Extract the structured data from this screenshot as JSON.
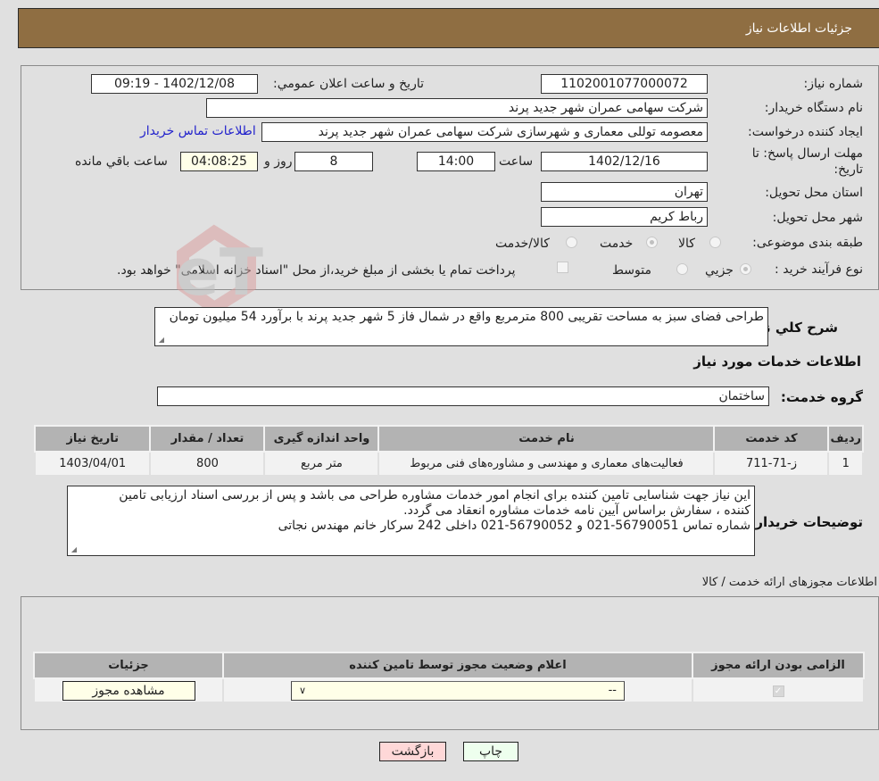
{
  "header": {
    "title": "جزئیات اطلاعات نیاز"
  },
  "form": {
    "need_number": {
      "label": "شماره نیاز:",
      "value": "1102001077000072"
    },
    "announce_datetime": {
      "label": "تاریخ و ساعت اعلان عمومي:",
      "value": "1402/12/08 - 09:19"
    },
    "buyer_org": {
      "label": "نام دستگاه خریدار:",
      "value": "شرکت سهامی عمران شهر جدید پرند"
    },
    "requester": {
      "label": "ایجاد کننده درخواست:",
      "value": "معصومه توللی معماری و شهرسازی شرکت سهامی عمران شهر جدید پرند"
    },
    "buyer_contact_link": "اطلاعات تماس خریدار",
    "deadline": {
      "label_line1": "مهلت ارسال پاسخ: تا",
      "label_line2": "تاریخ:",
      "date": "1402/12/16",
      "time_label": "ساعت",
      "time": "14:00",
      "days": "8",
      "days_label": "روز و",
      "remaining": "04:08:25",
      "remaining_label": "ساعت باقي مانده"
    },
    "province": {
      "label": "استان محل تحویل:",
      "value": "تهران"
    },
    "city": {
      "label": "شهر محل تحویل:",
      "value": "رباط کریم"
    },
    "category": {
      "label": "طبقه بندی موضوعی:",
      "options": [
        "کالا",
        "خدمت",
        "کالا/خدمت"
      ],
      "selected": "خدمت"
    },
    "process_type": {
      "label": "نوع فرآیند خرید :",
      "options": [
        "جزيي",
        "متوسط"
      ],
      "selected": "جزيي",
      "treasury_note": "پرداخت تمام یا بخشی از مبلغ خرید،از محل \"اسناد خزانه اسلامی\" خواهد بود."
    }
  },
  "summary": {
    "label": "شرح كلي نياز:",
    "text": "طراحی فضای سبز به مساحت تقریبی 800 مترمربع واقع در شمال فاز 5 شهر جدید پرند با برآورد 54 میلیون تومان"
  },
  "services": {
    "section_title": "اطلاعات خدمات مورد نیاز",
    "group_label": "گروه خدمت:",
    "group_value": "ساختمان",
    "columns": [
      "ردیف",
      "کد خدمت",
      "نام خدمت",
      "واحد اندازه گیری",
      "تعداد / مقدار",
      "تاریخ نیاز"
    ],
    "rows": [
      [
        "1",
        "ز-71-711",
        "فعالیت‌های معماری و مهندسی و مشاوره‌های فنی مربوط",
        "متر مربع",
        "800",
        "1403/04/01"
      ]
    ]
  },
  "buyer_notes": {
    "label": "توضیحات خریدار:",
    "lines": [
      " این نیاز جهت شناسایی تامین کننده برای انجام امور خدمات مشاوره طراحی می باشد و پس از بررسی اسناد ارزیابی تامین",
      "کننده ، سفارش براساس آیین نامه خدمات مشاوره انعقاد می گردد.",
      "شماره تماس 56790051-021 و 56790052-021 داخلی 242 سرکار خانم مهندس نجاتی"
    ]
  },
  "permits": {
    "section_title": "اطلاعات مجوزهای ارائه خدمت / کالا",
    "columns": [
      "الزامی بودن ارائه مجوز",
      "اعلام وضعیت مجوز توسط تامین کننده",
      "جزئیات"
    ],
    "row": {
      "required_checked": true,
      "status_select": "--",
      "details_button": "مشاهده مجوز"
    }
  },
  "actions": {
    "print": "چاپ",
    "back": "بازگشت"
  },
  "colors": {
    "header_bg": "#8f6e42",
    "link": "#2222cc",
    "back_btn_bg": "#ffd8d8",
    "print_btn_bg": "#eeffee"
  }
}
